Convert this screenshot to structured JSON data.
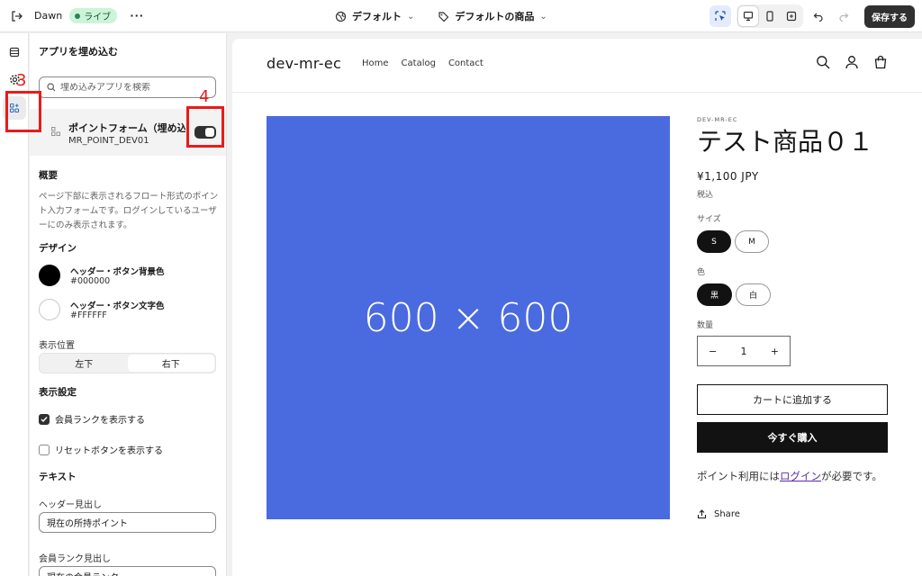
{
  "topbar": {
    "theme_name": "Dawn",
    "live_badge": "ライブ",
    "template_select": "デフォルト",
    "product_select": "デフォルトの商品",
    "save_label": "保存する"
  },
  "panel": {
    "title": "アプリを埋め込む",
    "search_placeholder": "埋め込みアプリを検索",
    "app": {
      "name": "ポイントフォーム（埋め込...",
      "handle": "MR_POINT_DEV01",
      "enabled": true
    },
    "overview_heading": "概要",
    "overview_text": "ページ下部に表示されるフロート形式のポイント入力フォームです。ログインしているユーザーにのみ表示されます。",
    "design_heading": "デザイン",
    "colors": [
      {
        "label": "ヘッダー・ボタン背景色",
        "value": "#000000"
      },
      {
        "label": "ヘッダー・ボタン文字色",
        "value": "#FFFFFF"
      }
    ],
    "position_label": "表示位置",
    "position_options": [
      "左下",
      "右下"
    ],
    "position_selected": "右下",
    "display_heading": "表示設定",
    "checkboxes": [
      {
        "label": "会員ランクを表示する",
        "checked": true
      },
      {
        "label": "リセットボタンを表示する",
        "checked": false
      }
    ],
    "text_heading": "テキスト",
    "fields": [
      {
        "label": "ヘッダー見出し",
        "value": "現在の所持ポイント"
      },
      {
        "label": "会員ランク見出し",
        "value": "現在の会員ランク"
      }
    ]
  },
  "callouts": {
    "three": "3",
    "four": "4",
    "color": "#ea1a1a"
  },
  "store": {
    "logo": "dev-mr-ec",
    "nav": [
      "Home",
      "Catalog",
      "Contact"
    ],
    "image_placeholder": "600 × 600",
    "image_color": "#4a6ae0",
    "vendor": "DEV-MR-EC",
    "title": "テスト商品０１",
    "price": "¥1,100 JPY",
    "tax": "税込",
    "size_label": "サイズ",
    "sizes": [
      "S",
      "M"
    ],
    "size_selected": "S",
    "color_label": "色",
    "color_options": [
      "黒",
      "白"
    ],
    "color_selected": "黒",
    "qty_label": "数量",
    "qty_minus": "−",
    "qty_value": "1",
    "qty_plus": "+",
    "add_to_cart": "カートに追加する",
    "buy_now": "今すぐ購入",
    "login_note_before": "ポイント利用には",
    "login_link": "ログイン",
    "login_note_after": "が必要です。",
    "share": "Share"
  }
}
